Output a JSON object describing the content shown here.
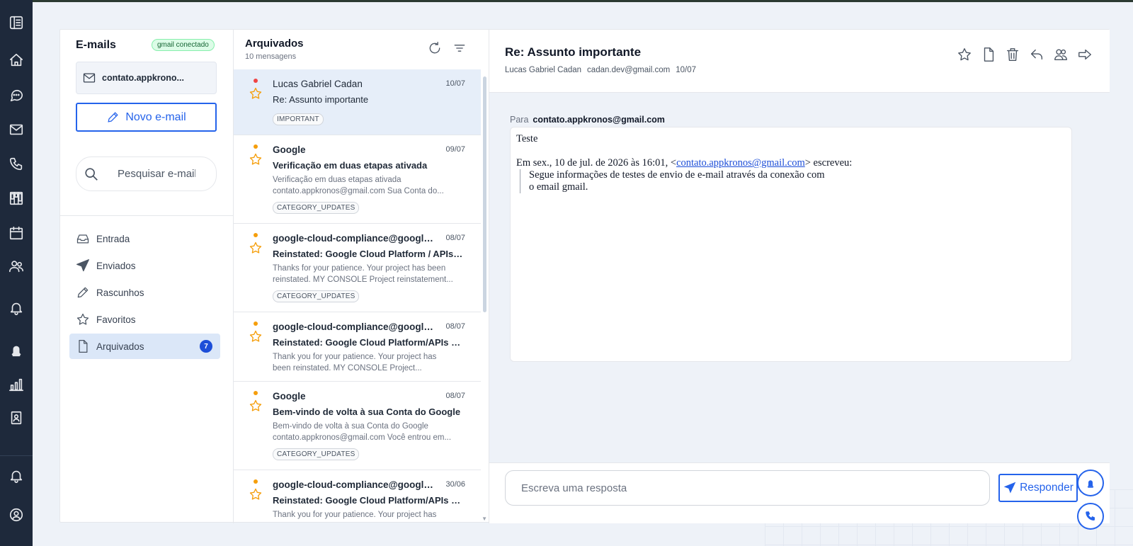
{
  "sidebar_rail": {
    "icons": [
      "sidebar-toggle-icon",
      "home-icon",
      "chat-icon",
      "mail-icon",
      "phone-icon",
      "kanban-icon",
      "calendar-icon",
      "users-icon",
      "bell-icon",
      "alert-bell-icon",
      "bar-chart-icon",
      "contact-card-icon",
      "notifications-icon",
      "user-profile-icon"
    ]
  },
  "left": {
    "title": "E-mails",
    "badge": "gmail conectado",
    "account": "contato.appkrono...",
    "new_email": "Novo e-mail",
    "search_placeholder": "Pesquisar e-mails",
    "nav": [
      {
        "label": "Entrada",
        "icon": "inbox-icon"
      },
      {
        "label": "Enviados",
        "icon": "send-icon"
      },
      {
        "label": "Rascunhos",
        "icon": "pencil-icon"
      },
      {
        "label": "Favoritos",
        "icon": "star-icon"
      },
      {
        "label": "Arquivados",
        "icon": "file-icon",
        "count": "7"
      }
    ]
  },
  "list": {
    "title": "Arquivados",
    "subtitle": "10 mensagens",
    "items": [
      {
        "from": "Lucas Gabriel Cadan",
        "date": "10/07",
        "subject": "Re: Assunto importante",
        "snippet1": "",
        "snippet2": "",
        "tag": "IMPORTANT",
        "dot": "#ef4444"
      },
      {
        "from": "Google",
        "date": "09/07",
        "subject": "Verificação em duas etapas ativada",
        "snippet1": "Verificação em duas etapas ativada",
        "snippet2": "contato.appkronos@gmail.com Sua Conta do...",
        "tag": "CATEGORY_UPDATES",
        "dot": "#f59e0b"
      },
      {
        "from": "google-cloud-compliance@google.com",
        "date": "08/07",
        "subject": "Reinstated: Google Cloud Platform / APIs project",
        "snippet1": "Thanks for your patience. Your project has been",
        "snippet2": "reinstated. MY CONSOLE Project reinstatement...",
        "tag": "CATEGORY_UPDATES",
        "dot": "#f59e0b"
      },
      {
        "from": "google-cloud-compliance@google.com",
        "date": "08/07",
        "subject": "Reinstated: Google Cloud Platform/APIs project",
        "snippet1": "Thank you for your patience. Your project has",
        "snippet2": "been reinstated. MY CONSOLE Project...",
        "tag": "",
        "dot": "#f59e0b"
      },
      {
        "from": "Google",
        "date": "08/07",
        "subject": "Bem-vindo de volta à sua Conta do Google",
        "snippet1": "Bem-vindo de volta à sua Conta do Google",
        "snippet2": "contato.appkronos@gmail.com Você entrou em...",
        "tag": "CATEGORY_UPDATES",
        "dot": "#f59e0b"
      },
      {
        "from": "google-cloud-compliance@google.com",
        "date": "30/06",
        "subject": "Reinstated: Google Cloud Platform/APIs project",
        "snippet1": "Thank you for your patience. Your project has",
        "snippet2": "",
        "tag": "",
        "dot": "#f59e0b"
      }
    ]
  },
  "reader": {
    "subject": "Re: Assunto importante",
    "sender_name": "Lucas Gabriel Cadan",
    "sender_email": "cadan.dev@gmail.com",
    "date": "10/07",
    "to_label": "Para",
    "to_value": "contato.appkronos@gmail.com",
    "body_line1": "Teste",
    "quote_header_pre": "Em sex., 10 de jul. de 2026 às 16:01, <",
    "quote_header_link": "contato.appkronos@gmail.com",
    "quote_header_post": "> escreveu:",
    "quote_line1": "Segue informações de testes de envio de e-mail através da conexão com",
    "quote_line2": "o email gmail.",
    "reply_placeholder": "Escreva uma resposta",
    "reply_button": "Responder"
  },
  "colors": {
    "accent": "#2563eb",
    "rail": "#1e293b",
    "selected": "#e6eef9",
    "star": "#f59e0b"
  }
}
